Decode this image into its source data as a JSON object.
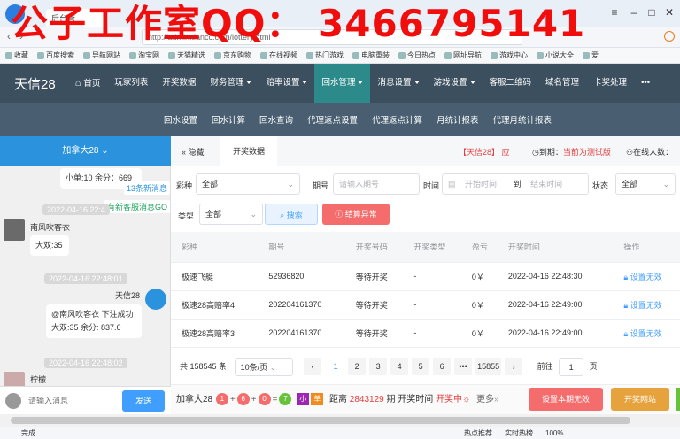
{
  "browser": {
    "tab_title": "后台管",
    "url": "http://admin.tiancc.com/lottery.html",
    "watermark": "公子工作室QQ： 3466795141",
    "bookmarks": [
      "收藏",
      "百度搜索",
      "导航网站",
      "淘宝网",
      "天猫精选",
      "京东购物",
      "在线视频",
      "热门游戏",
      "电脑重装",
      "今日热点",
      "网址导航",
      "游戏中心",
      "小说大全",
      "爱"
    ],
    "status_left": "完成",
    "status_items": [
      "热点推荐",
      "实时热榜",
      "100%"
    ]
  },
  "app": {
    "logo": "天信28",
    "nav": [
      "首页",
      "玩家列表",
      "开奖数据",
      "财务管理",
      "赔率设置",
      "回水管理",
      "消息设置",
      "游戏设置",
      "客服二维码",
      "域名管理",
      "卡奖处理"
    ],
    "nav_dropdown": [
      false,
      false,
      false,
      true,
      true,
      true,
      true,
      true,
      false,
      false,
      false
    ],
    "nav_active": "回水管理",
    "more": "•••",
    "subnav": [
      "回水设置",
      "回水计算",
      "回水查询",
      "代理返点设置",
      "代理返点计算",
      "月统计报表",
      "代理月统计报表"
    ]
  },
  "chat": {
    "header": "加拿大28",
    "messages": [
      {
        "text": "小单:10 余分：669"
      },
      {
        "text": "13条新消息"
      },
      {
        "text": "有新客服消息GO"
      },
      {
        "time": "2022-04-16 22:4"
      },
      {
        "name": "南风吹客衣",
        "text": "大双:35"
      },
      {
        "time": "2022-04-16 22:48:01"
      },
      {
        "name": "天信28",
        "line1": "@南风吹客衣 下注成功",
        "line2": "大双:35 余分: 837.6"
      },
      {
        "time": "2022-04-16 22:48:02"
      },
      {
        "name": "柠檬"
      }
    ],
    "input_placeholder": "请输入消息",
    "send_label": "发送"
  },
  "panel": {
    "hide_label": "隐藏",
    "tab_label": "开奖数据",
    "notice": "【天信28】 应",
    "expire_label": "到期：",
    "expire_value": "当前为测试版",
    "online_label": "在线人数：",
    "filters": {
      "game_label": "彩种",
      "game_value": "全部",
      "period_label": "期号",
      "period_placeholder": "请输入期号",
      "time_label": "时间",
      "start_placeholder": "开始时间",
      "to_label": "到",
      "end_placeholder": "结束时间",
      "status_label": "状态",
      "status_value": "全部",
      "type_label": "类型",
      "type_value": "全部",
      "search_label": "搜索",
      "abnormal_label": "结算异常"
    },
    "table": {
      "headers": [
        "彩种",
        "期号",
        "开奖号码",
        "开奖类型",
        "盈亏",
        "开奖时间",
        "操作"
      ],
      "rows": [
        [
          "极速飞艇",
          "52936820",
          "等待开奖",
          "-",
          "0￥",
          "2022-04-16 22:48:30",
          "设置无效"
        ],
        [
          "极速28高赔率4",
          "202204161370",
          "等待开奖",
          "-",
          "0￥",
          "2022-04-16 22:49:00",
          "设置无效"
        ],
        [
          "极速28高赔率3",
          "202204161370",
          "等待开奖",
          "-",
          "0￥",
          "2022-04-16 22:49:00",
          "设置无效"
        ]
      ]
    },
    "pagination": {
      "total": "共 158545 条",
      "per_page": "10条/页",
      "pages": [
        "1",
        "2",
        "3",
        "4",
        "5",
        "6",
        "•••",
        "15855"
      ],
      "active": "1",
      "goto_label": "前往",
      "goto_value": "1",
      "page_suffix": "页"
    },
    "footer": {
      "game": "加拿大28",
      "balls": [
        "1",
        "6",
        "0",
        "7"
      ],
      "ops": [
        "+",
        "+",
        "="
      ],
      "tags": [
        "小",
        "单"
      ],
      "countdown_label": "距离",
      "countdown_value": "2843129",
      "countdown_suffix": "期 开奖时间",
      "state": "开奖中",
      "more": "更多",
      "invalid_btn": "设置本期无效",
      "open_btn": "开奖网站"
    }
  },
  "colors": {
    "nav_bg": "#3c4f5f",
    "nav_active": "#2c8a8a",
    "accent": "#409eff",
    "danger": "#f56c6c",
    "chat_header": "#2b92de",
    "watermark": "#f20d0d"
  }
}
